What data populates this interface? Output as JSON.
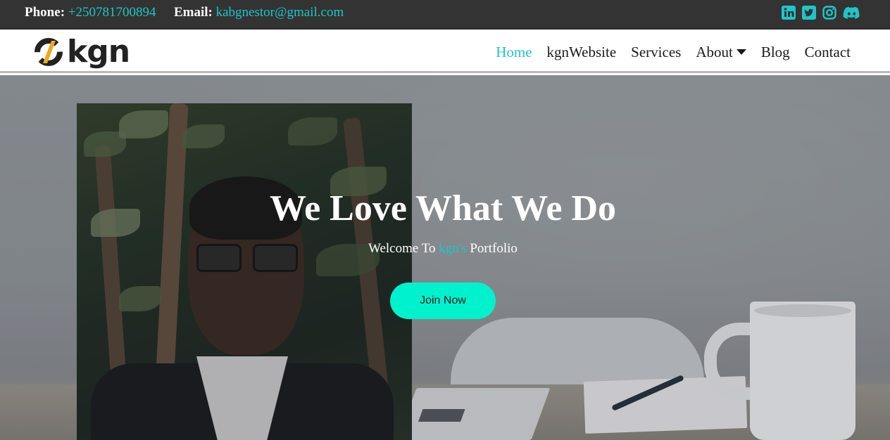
{
  "topbar": {
    "phone_label": "Phone",
    "phone_value": "+250781700894",
    "email_label": "Email",
    "email_value": "kabgnestor@gmail.com",
    "socials": [
      "linkedin-icon",
      "twitter-icon",
      "instagram-icon",
      "discord-icon"
    ]
  },
  "brand": {
    "logo_text": "kgn"
  },
  "nav": {
    "items": [
      {
        "label": "Home",
        "active": true
      },
      {
        "label": "kgnWebsite"
      },
      {
        "label": "Services"
      },
      {
        "label": "About"
      },
      {
        "label": "Blog"
      },
      {
        "label": "Contact"
      }
    ]
  },
  "hero": {
    "title": "We Love What We Do",
    "subtitle_prefix": "Welcome To ",
    "subtitle_accent": "kgn's",
    "subtitle_suffix": " Portfolio",
    "cta_label": "Join Now"
  },
  "colors": {
    "accent": "#1ec6c8",
    "topbar_bg": "#333333",
    "cta_bg": "#00f2cc"
  }
}
